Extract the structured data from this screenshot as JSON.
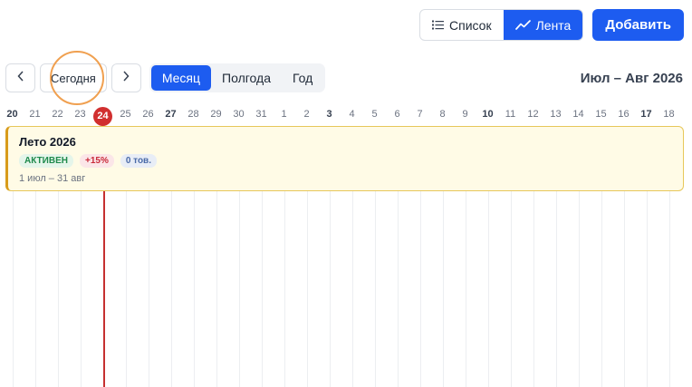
{
  "toolbar": {
    "list_label": "Список",
    "feed_label": "Лента",
    "add_label": "Добавить"
  },
  "nav": {
    "today_label": "Сегодня",
    "scales": [
      "Месяц",
      "Полгода",
      "Год"
    ],
    "active_scale": "Месяц",
    "range_label": "Июл – Авг 2026"
  },
  "timeline": {
    "days": [
      "20",
      "21",
      "22",
      "23",
      "24",
      "25",
      "26",
      "27",
      "28",
      "29",
      "30",
      "31",
      "1",
      "2",
      "3",
      "4",
      "5",
      "6",
      "7",
      "8",
      "9",
      "10",
      "11",
      "12",
      "13",
      "14",
      "15",
      "16",
      "17",
      "18"
    ],
    "bold_days": [
      "20",
      "27",
      "3",
      "10",
      "17"
    ],
    "today": "24"
  },
  "event": {
    "title": "Лето 2026",
    "status": "АКТИВЕН",
    "percent": "+15%",
    "count": "0 тов.",
    "dates": "1 июл – 31 авг"
  },
  "colors": {
    "accent": "#1d5cf0",
    "today": "#d12f2f",
    "event_bg": "#fffbe6",
    "event_border": "#e7c75a"
  }
}
